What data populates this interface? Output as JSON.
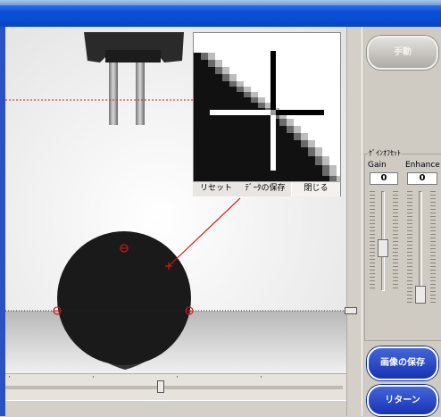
{
  "zoom_popup": {
    "reset_label": "リセット",
    "save_data_label": "ﾃﾞｰﾀの保存",
    "close_label": "閉じる"
  },
  "right_panel": {
    "manual_label": "手動",
    "gain_group_title": "ｹﾞｲﾝｵﾌｾｯﾄ",
    "gain_label": "Gain",
    "enhance_label": "Enhance",
    "gain_value": "0",
    "enhance_value": "0",
    "save_image_label": "画像の保存",
    "return_label": "リターン"
  },
  "colors": {
    "title_bar": "#0a51d8",
    "button_blue": "#1633b6",
    "marker_red": "#d01818",
    "droplet": "#1a1a1a"
  }
}
